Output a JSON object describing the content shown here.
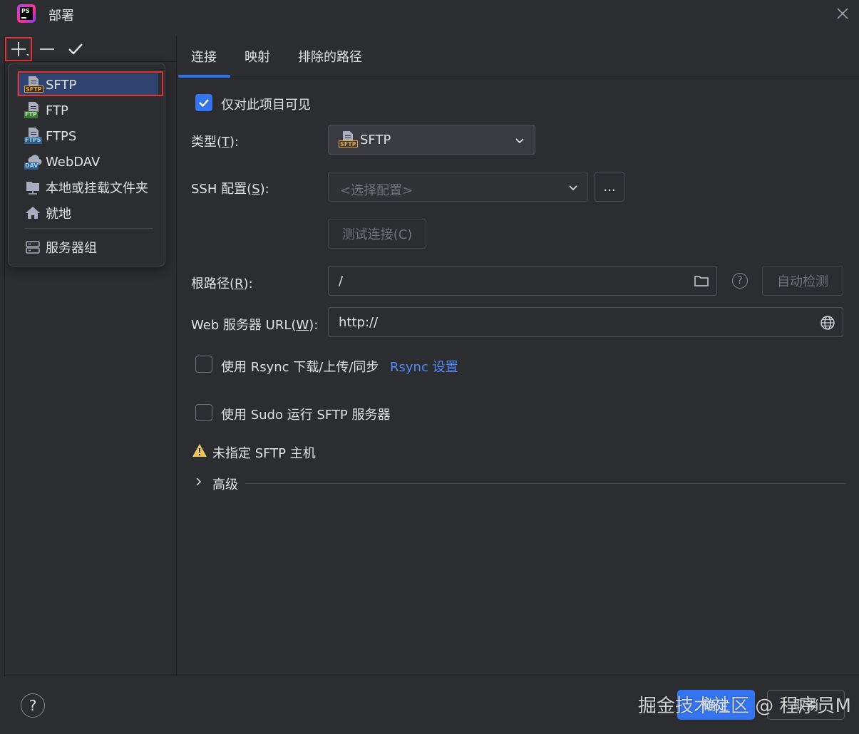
{
  "window": {
    "title": "部署",
    "app_icon_text": "PS"
  },
  "toolbar": {
    "add": "add-icon",
    "remove": "minus-icon",
    "apply": "check-icon"
  },
  "add_menu": {
    "items": [
      {
        "label": "SFTP",
        "icon": "sftp-icon",
        "tag": "SFTP",
        "selected": true
      },
      {
        "label": "FTP",
        "icon": "ftp-icon",
        "tag": "FTP"
      },
      {
        "label": "FTPS",
        "icon": "ftps-icon",
        "tag": "FTPS"
      },
      {
        "label": "WebDAV",
        "icon": "webdav-icon",
        "tag": "DAV"
      },
      {
        "label": "本地或挂载文件夹",
        "icon": "folder-icon"
      },
      {
        "label": "就地",
        "icon": "home-icon"
      }
    ],
    "group_item": {
      "label": "服务器组",
      "icon": "server-group-icon"
    }
  },
  "tabs": [
    {
      "label": "连接",
      "active": true
    },
    {
      "label": "映射"
    },
    {
      "label": "排除的路径"
    }
  ],
  "form": {
    "visible_only_project": {
      "label": "仅对此项目可见",
      "checked": true
    },
    "type": {
      "label": "类型(T):",
      "label_main": "类型(",
      "mnemonic": "T",
      "label_tail": "):",
      "value": "SFTP",
      "tag": "SFTP"
    },
    "ssh_config": {
      "label_main": "SSH 配置(",
      "mnemonic": "S",
      "label_tail": "):",
      "placeholder": "<选择配置>",
      "browse_label": "..."
    },
    "test_connection": {
      "label": "测试连接(C)"
    },
    "root_path": {
      "label_main": "根路径(",
      "mnemonic": "R",
      "label_tail": "):",
      "value": "/",
      "autodetect_label": "自动检测",
      "help": "?"
    },
    "web_url": {
      "label_main": "Web 服务器 URL(",
      "mnemonic": "W",
      "label_tail": "):",
      "value": "http://"
    },
    "rsync": {
      "label": "使用 Rsync 下载/上传/同步",
      "checked": false,
      "link": "Rsync 设置"
    },
    "sudo": {
      "label": "使用 Sudo 运行 SFTP 服务器",
      "checked": false
    },
    "warning": {
      "text": "未指定 SFTP 主机"
    },
    "advanced": {
      "label": "高级"
    }
  },
  "footer": {
    "help": "?",
    "ok_label": "确定",
    "cancel_label": "取消"
  },
  "watermark": "掘金技术社区 @ 程序员M",
  "colors": {
    "accent": "#3574f0",
    "background": "#2b2d30",
    "highlight": "#e03535",
    "warning": "#f2c55c",
    "link": "#548af7"
  }
}
